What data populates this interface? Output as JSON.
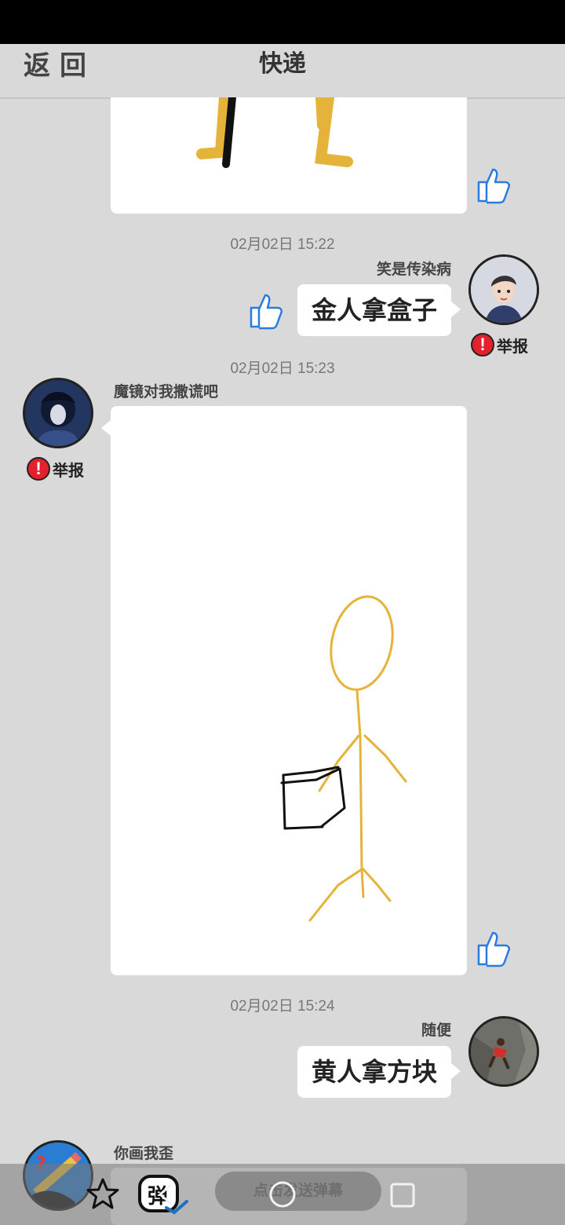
{
  "header": {
    "back_label": "返回",
    "title": "快递"
  },
  "messages": [
    {
      "time": "02月02日 15:22",
      "sender": "笑是传染病",
      "text": "金人拿盒子",
      "report_label": "举报"
    },
    {
      "time": "02月02日 15:23",
      "sender": "魔镜对我撒谎吧",
      "report_label": "举报"
    },
    {
      "time": "02月02日 15:24",
      "sender": "随便",
      "text": "黄人拿方块"
    },
    {
      "sender": "你画我歪"
    }
  ],
  "bottom_bar": {
    "danmaku_placeholder": "点击发送弹幕"
  },
  "colors": {
    "background": "#d9d9d9",
    "report_red": "#e3202c",
    "drawing_yellow": "#e6b33a",
    "thumb_blue": "#2a7be0"
  }
}
